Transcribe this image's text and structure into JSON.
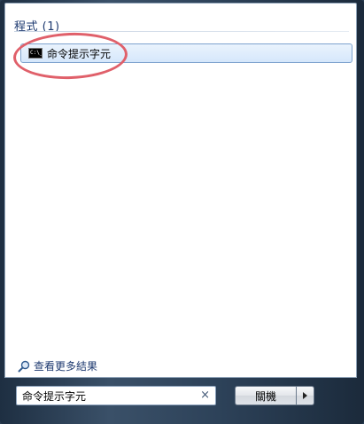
{
  "results": {
    "section_header": "程式 (1)",
    "items": [
      {
        "label": "命令提示字元",
        "icon": "command-prompt-icon",
        "icon_text": "C:\\_"
      }
    ]
  },
  "see_more": {
    "label": "查看更多結果",
    "icon": "magnifier-icon"
  },
  "search": {
    "value": "命令提示字元",
    "clear_symbol": "×"
  },
  "power": {
    "shutdown_label": "關機",
    "options_icon": "arrow-right-icon"
  },
  "colors": {
    "annotation_circle": "#e0606a",
    "header_text": "#1e3a70",
    "selection_border": "#7da2ce"
  }
}
